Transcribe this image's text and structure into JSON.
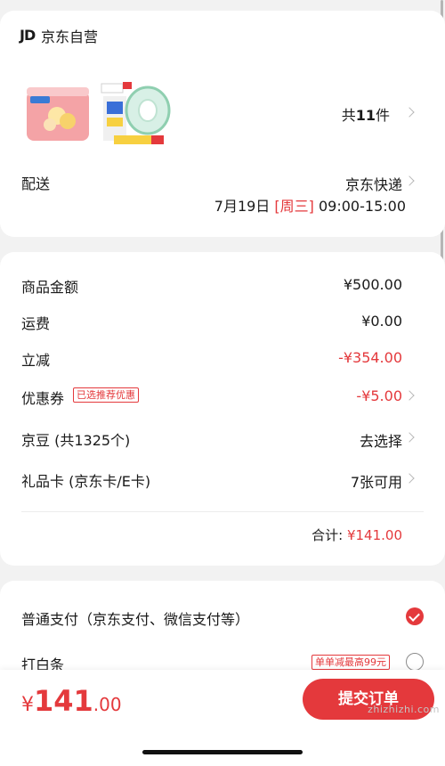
{
  "shop": {
    "logo": "JD",
    "name": "京东自营",
    "item_count_prefix": "共",
    "item_count": "11",
    "item_count_suffix": "件"
  },
  "delivery": {
    "label": "配送",
    "method": "京东快递",
    "date": "7月19日",
    "weekday": "[周三]",
    "time": "09:00-15:00"
  },
  "price": {
    "goods_label": "商品金额",
    "goods_value": "¥500.00",
    "freight_label": "运费",
    "freight_value": "¥0.00",
    "discount_label": "立减",
    "discount_value": "-¥354.00",
    "coupon_label": "优惠券",
    "coupon_tag": "已选推荐优惠",
    "coupon_value": "-¥5.00",
    "beans_label": "京豆 (共1325个)",
    "beans_value": "去选择",
    "giftcard_label": "礼品卡 (京东卡/E卡)",
    "giftcard_value": "7张可用",
    "total_label": "合计:",
    "total_value": "¥141.00"
  },
  "payment": {
    "normal_label": "普通支付（京东支付、微信支付等）",
    "baitiao_label": "打白条",
    "baitiao_promo": "单单减最高99元"
  },
  "bottom": {
    "currency": "¥",
    "amount_int": "141",
    "amount_dec": ".00",
    "submit_label": "提交订单"
  },
  "watermark": "zhizhizhi.com",
  "colors": {
    "accent": "#e4393c",
    "background": "#f2f2f2",
    "card": "#ffffff"
  }
}
